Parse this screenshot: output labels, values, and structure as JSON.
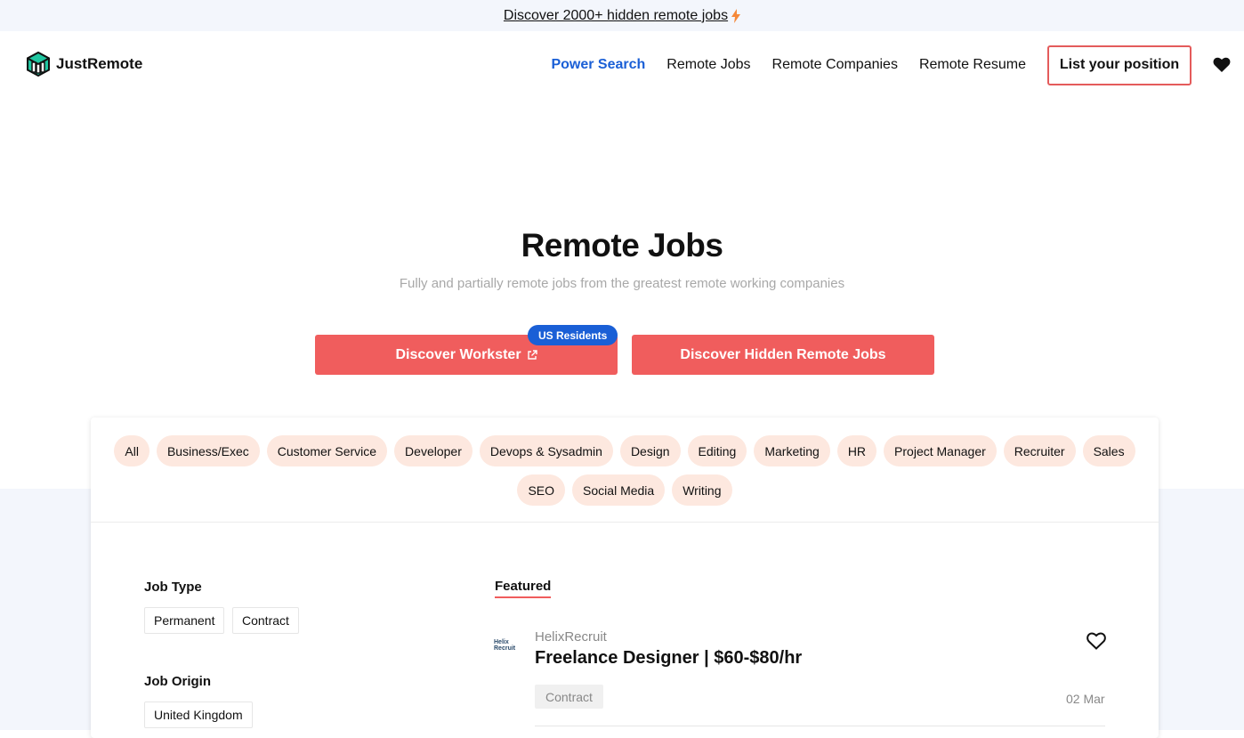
{
  "promo": {
    "text": "Discover 2000+ hidden remote jobs",
    "icon": "lightning-icon"
  },
  "nav": {
    "logo_text": "JustRemote",
    "links": [
      "Power Search",
      "Remote Jobs",
      "Remote Companies",
      "Remote Resume"
    ],
    "cta": "List your position"
  },
  "hero": {
    "title": "Remote Jobs",
    "subtitle": "Fully and partially remote jobs from the greatest remote working companies",
    "btn_workster": "Discover Workster",
    "badge": "US Residents",
    "btn_hidden": "Discover Hidden Remote Jobs"
  },
  "categories": [
    "All",
    "Business/Exec",
    "Customer Service",
    "Developer",
    "Devops & Sysadmin",
    "Design",
    "Editing",
    "Marketing",
    "HR",
    "Project Manager",
    "Recruiter",
    "Sales",
    "SEO",
    "Social Media",
    "Writing"
  ],
  "filters": {
    "job_type_label": "Job Type",
    "job_types": [
      "Permanent",
      "Contract"
    ],
    "job_origin_label": "Job Origin",
    "job_origins": [
      "United Kingdom"
    ]
  },
  "featured": {
    "tab_label": "Featured",
    "job": {
      "logo_text_1": "Helix",
      "logo_text_2": "Recruit",
      "company": "HelixRecruit",
      "title": "Freelance Designer | $60-$80/hr",
      "tag": "Contract",
      "date": "02 Mar"
    }
  },
  "colors": {
    "accent": "#f05d5d",
    "blue": "#1a5fd6",
    "chip": "#fde8df",
    "band": "#f3f6fc"
  }
}
